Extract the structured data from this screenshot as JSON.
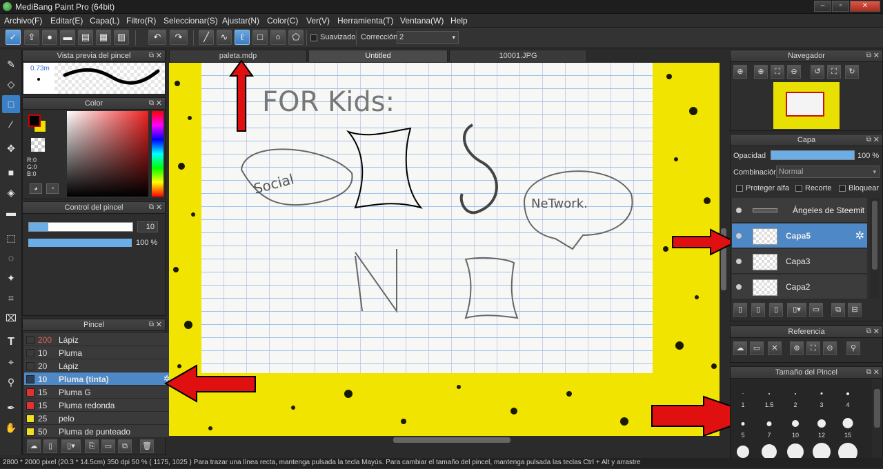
{
  "app": {
    "title": "MediBang Paint Pro (64bit)"
  },
  "menu": [
    "Archivo(F)",
    "Editar(E)",
    "Capa(L)",
    "Filtro(R)",
    "Seleccionar(S)",
    "Ajustar(N)",
    "Color(C)",
    "Ver(V)",
    "Herramienta(T)",
    "Ventana(W)",
    "Help"
  ],
  "toolbar": {
    "smoothing_label": "Suavizado",
    "correction_label": "Corrección",
    "correction_value": "2"
  },
  "tabs": [
    "paleta.mdp",
    "Untitled",
    "10001.JPG"
  ],
  "brush_preview": {
    "title": "Vista previa del pincel",
    "size": "0.73m"
  },
  "color_panel": {
    "title": "Color",
    "r": "R:0",
    "g": "G:0",
    "b": "B:0"
  },
  "brush_control": {
    "title": "Control del pincel",
    "size": "10",
    "opacity": "100 %"
  },
  "brush_panel": {
    "title": "Pincel",
    "items": [
      {
        "size": "200",
        "name": "Lápiz",
        "color": "#3a3a3a",
        "selected": false
      },
      {
        "size": "10",
        "name": "Pluma",
        "color": "#3a3a3a",
        "selected": false
      },
      {
        "size": "20",
        "name": "Lápiz",
        "color": "#3a3a3a",
        "selected": false
      },
      {
        "size": "10",
        "name": "Pluma (tinta)",
        "color": "#2a3f5a",
        "selected": true
      },
      {
        "size": "15",
        "name": "Pluma G",
        "color": "#e63030",
        "selected": false
      },
      {
        "size": "15",
        "name": "Pluma redonda",
        "color": "#e63030",
        "selected": false
      },
      {
        "size": "25",
        "name": "pelo",
        "color": "#f0e020",
        "selected": false
      },
      {
        "size": "50",
        "name": "Pluma de punteado",
        "color": "#f0e020",
        "selected": false
      }
    ]
  },
  "navigator": {
    "title": "Navegador"
  },
  "layer_panel": {
    "title": "Capa",
    "opacity_label": "Opacidad",
    "opacity_value": "100 %",
    "blend_label": "Combinación",
    "blend_value": "Normal",
    "protect_alpha": "Proteger alfa",
    "clip": "Recorte",
    "lock": "Bloquear",
    "layers": [
      {
        "name": "Ángeles de Steemit",
        "selected": false
      },
      {
        "name": "Capa5",
        "selected": true
      },
      {
        "name": "Capa3",
        "selected": false
      },
      {
        "name": "Capa2",
        "selected": false
      }
    ]
  },
  "reference_panel": {
    "title": "Referencia"
  },
  "brush_size_panel": {
    "title": "Tamaño del Pincel",
    "sizes_row1": [
      "1",
      "1.5",
      "2",
      "3",
      "4"
    ],
    "sizes_row2": [
      "5",
      "7",
      "10",
      "12",
      "15"
    ]
  },
  "canvas": {
    "text_title": "FOR Kids:",
    "text_left": "Social",
    "text_right": "NeTwork."
  },
  "status": {
    "text": "2800 * 2000 pixel   (20.3 * 14.5cm)  350 dpi   50 %   ( 1175, 1025 )   Para trazar una línea recta, mantenga pulsada la tecla Mayús. Para cambiar el tamaño del pincel, mantenga pulsada las teclas Ctrl + Alt y arrastre"
  },
  "colors": {
    "accent": "#4e88c6",
    "arrow": "#e01010",
    "canvas_bg": "#f0e400"
  }
}
